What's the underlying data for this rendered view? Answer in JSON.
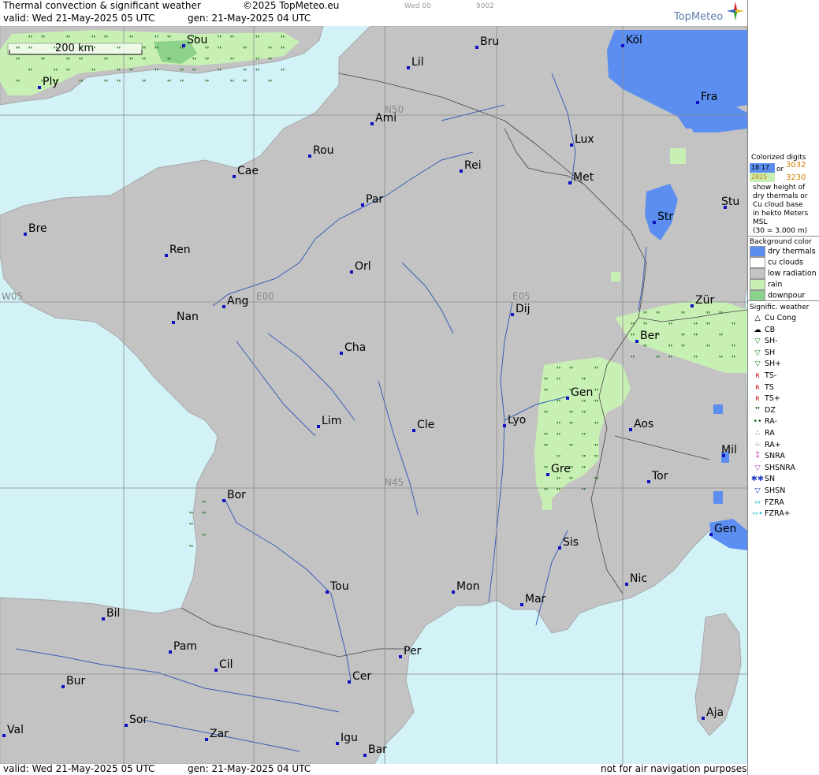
{
  "header": {
    "title": "Thermal convection & significant weather",
    "copyright": "©2025 TopMeteo.eu",
    "valid": "valid:  Wed  21-May-2025  05 UTC",
    "generated": "gen: 21-May-2025 04 UTC",
    "small_day": "Wed 00",
    "small_code": "9002",
    "logo": "TopMeteo"
  },
  "footer": {
    "valid": "valid:  Wed  21-May-2025  05 UTC",
    "generated": "gen: 21-May-2025 04 UTC",
    "disclaimer": "not for air navigation purposes"
  },
  "map": {
    "scale_label": "200 km",
    "coord_labels": [
      "N50",
      "N45",
      "W05",
      "E00",
      "E05"
    ],
    "cities": [
      "Sou",
      "Ply",
      "Lil",
      "Bru",
      "Köl",
      "Fra",
      "Ami",
      "Lux",
      "Rou",
      "Cae",
      "Rei",
      "Met",
      "Par",
      "Str",
      "Stu",
      "Bre",
      "Ren",
      "Orl",
      "Ang",
      "Nan",
      "Dij",
      "Zür",
      "Ber",
      "Cha",
      "Gen",
      "Lim",
      "Cle",
      "Lyo",
      "Aos",
      "Mil",
      "Gre",
      "Tor",
      "Bor",
      "Sis",
      "Gen",
      "Tou",
      "Mon",
      "Mar",
      "Nic",
      "Bil",
      "Pam",
      "Cil",
      "Per",
      "Bur",
      "Cer",
      "Sor",
      "Aja",
      "Val",
      "Zar",
      "Igu",
      "Bar"
    ],
    "colors": {
      "sea": "#d2f2f8",
      "land": "#c3c3c3",
      "dry_thermals": "#5b8ef0",
      "rain": "#c8f0b4",
      "downpour": "#8cd28c"
    }
  },
  "legend": {
    "colorized_title": "Colorized digits",
    "digits_a": "18 17",
    "digits_b": "3032",
    "digits_c": "2825",
    "digits_d": "3230",
    "or": "or",
    "explain": [
      "show height of",
      "dry thermals or",
      "Cu cloud base",
      "in hekto Meters",
      "MSL",
      "(30 = 3.000 m)"
    ],
    "bg_title": "Background color",
    "bg_items": [
      {
        "label": "dry thermals",
        "color": "#5b8ef0"
      },
      {
        "label": "cu clouds",
        "color": "#ffffff"
      },
      {
        "label": "low radiation",
        "color": "#c3c3c3"
      },
      {
        "label": "rain",
        "color": "#c8f0b4"
      },
      {
        "label": "downpour",
        "color": "#8cd28c"
      }
    ],
    "wx_title": "Signific. weather",
    "wx_items": [
      {
        "label": "Cu Cong",
        "sym": "△",
        "color": "#000000"
      },
      {
        "label": "CB",
        "sym": "☁",
        "color": "#000000"
      },
      {
        "label": "SH-",
        "sym": "▽",
        "color": "#2a8a2a"
      },
      {
        "label": "SH",
        "sym": "▽",
        "color": "#2a8a2a"
      },
      {
        "label": "SH+",
        "sym": "▽",
        "color": "#2a8a2a"
      },
      {
        "label": "TS-",
        "sym": "ʀ",
        "color": "#d02020"
      },
      {
        "label": "TS",
        "sym": "ʀ",
        "color": "#d02020"
      },
      {
        "label": "TS+",
        "sym": "ʀ",
        "color": "#d02020"
      },
      {
        "label": "DZ",
        "sym": "❜❜",
        "color": "#1a6a1a"
      },
      {
        "label": "RA-",
        "sym": "••",
        "color": "#1a6a1a"
      },
      {
        "label": "RA",
        "sym": "∴",
        "color": "#1a6a1a"
      },
      {
        "label": "RA+",
        "sym": "⁘",
        "color": "#1a6a1a"
      },
      {
        "label": "SNRA",
        "sym": "⁑",
        "color": "#c040c0"
      },
      {
        "label": "SHSNRA",
        "sym": "▽",
        "color": "#c040c0"
      },
      {
        "label": "SN",
        "sym": "✱✱",
        "color": "#2040c0"
      },
      {
        "label": "SHSN",
        "sym": "▽",
        "color": "#2040c0"
      },
      {
        "label": "FZRA",
        "sym": "∾",
        "color": "#20c0d0"
      },
      {
        "label": "FZRA+",
        "sym": "∾•",
        "color": "#20c0d0"
      }
    ]
  }
}
